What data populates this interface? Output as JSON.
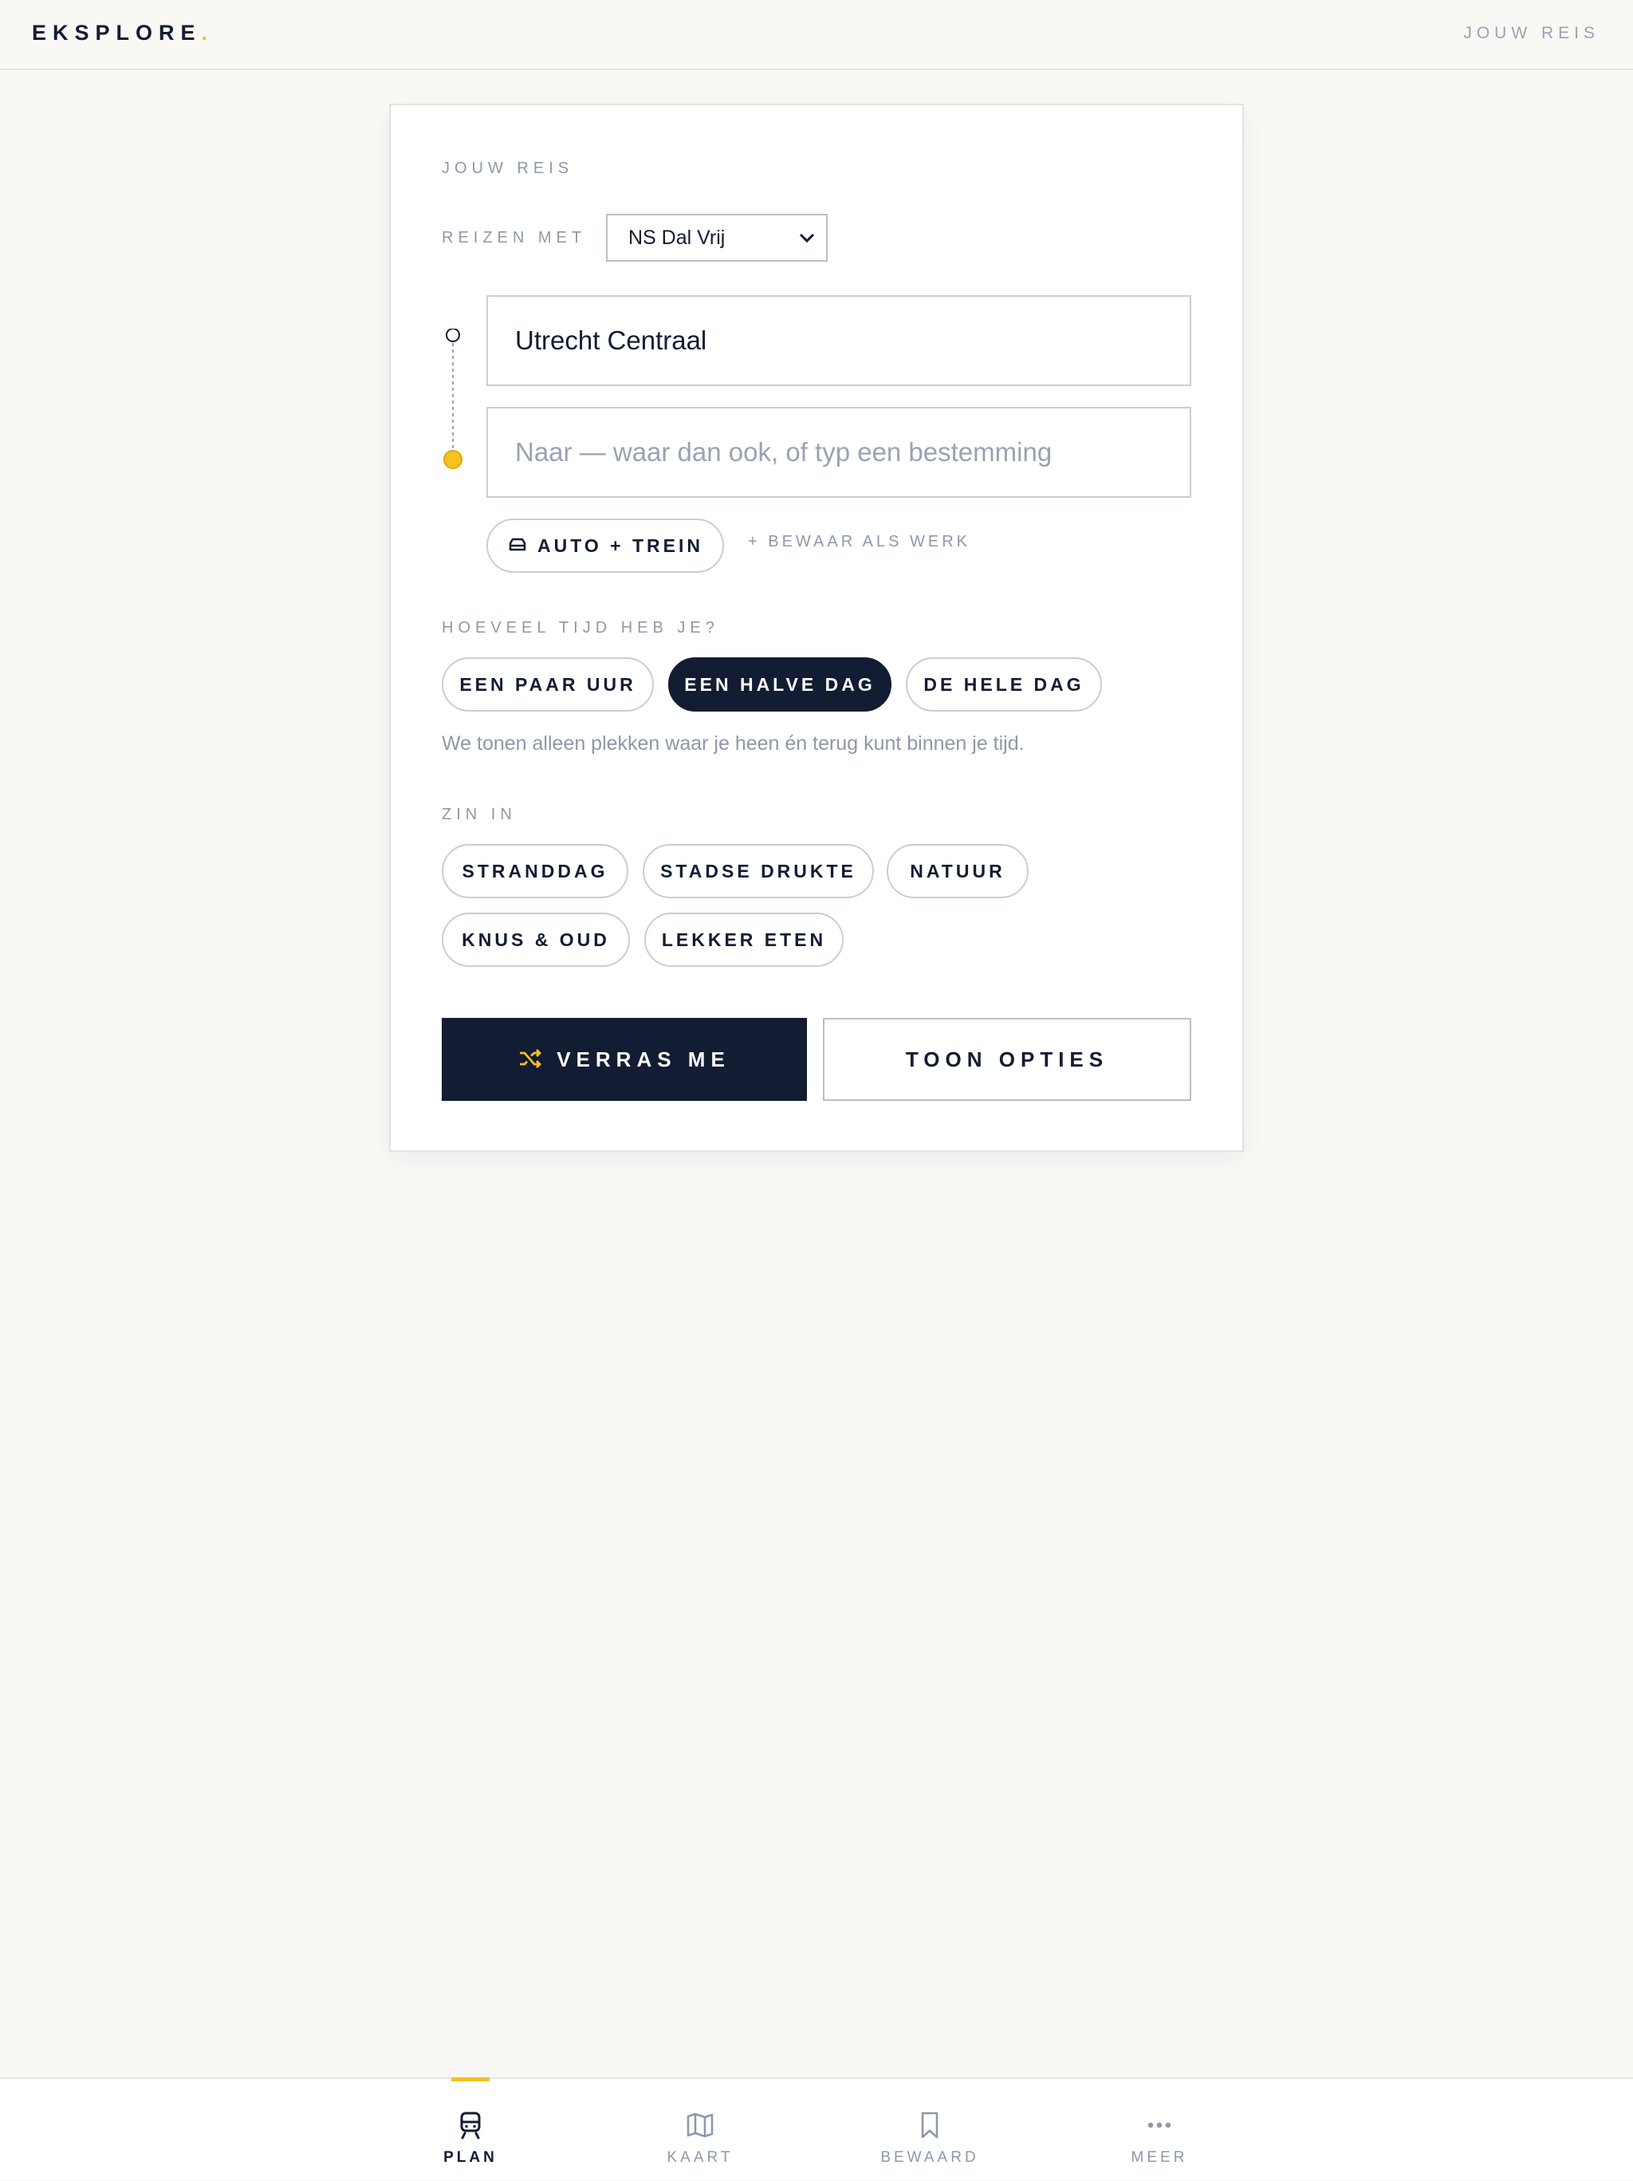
{
  "header": {
    "brand": "EKSPLORE",
    "brand_dot": ".",
    "link": "JOUW REIS"
  },
  "form": {
    "section_title": "JOUW REIS",
    "travel_with_label": "REIZEN MET",
    "travel_with_value": "NS Dal Vrij",
    "from_value": "Utrecht Centraal",
    "to_placeholder": "Naar — waar dan ook, of typ een bestemming",
    "car_train_label": "AUTO + TREIN",
    "save_work_label": "+ BEWAAR ALS WERK",
    "time_title": "HOEVEEL TIJD HEB JE?",
    "time_options": [
      "EEN PAAR UUR",
      "EEN HALVE DAG",
      "DE HELE DAG"
    ],
    "time_selected": "EEN HALVE DAG",
    "time_hint": "We tonen alleen plekken waar je heen én terug kunt binnen je tijd.",
    "mood_title": "ZIN IN",
    "mood_options": [
      "STRANDDAG",
      "STADSE DRUKTE",
      "NATUUR",
      "KNUS & OUD",
      "LEKKER ETEN"
    ],
    "surprise_label": "VERRAS ME",
    "options_label": "TOON OPTIES"
  },
  "tabbar": {
    "tabs": [
      {
        "label": "PLAN",
        "icon": "train-icon",
        "active": true
      },
      {
        "label": "KAART",
        "icon": "map-icon",
        "active": false
      },
      {
        "label": "BEWAARD",
        "icon": "bookmark-icon",
        "active": false
      },
      {
        "label": "MEER",
        "icon": "more-icon",
        "active": false
      }
    ]
  },
  "colors": {
    "ink": "#121c33",
    "accent": "#f5c220",
    "muted": "#8f98aa",
    "background": "#f9f8f5"
  }
}
